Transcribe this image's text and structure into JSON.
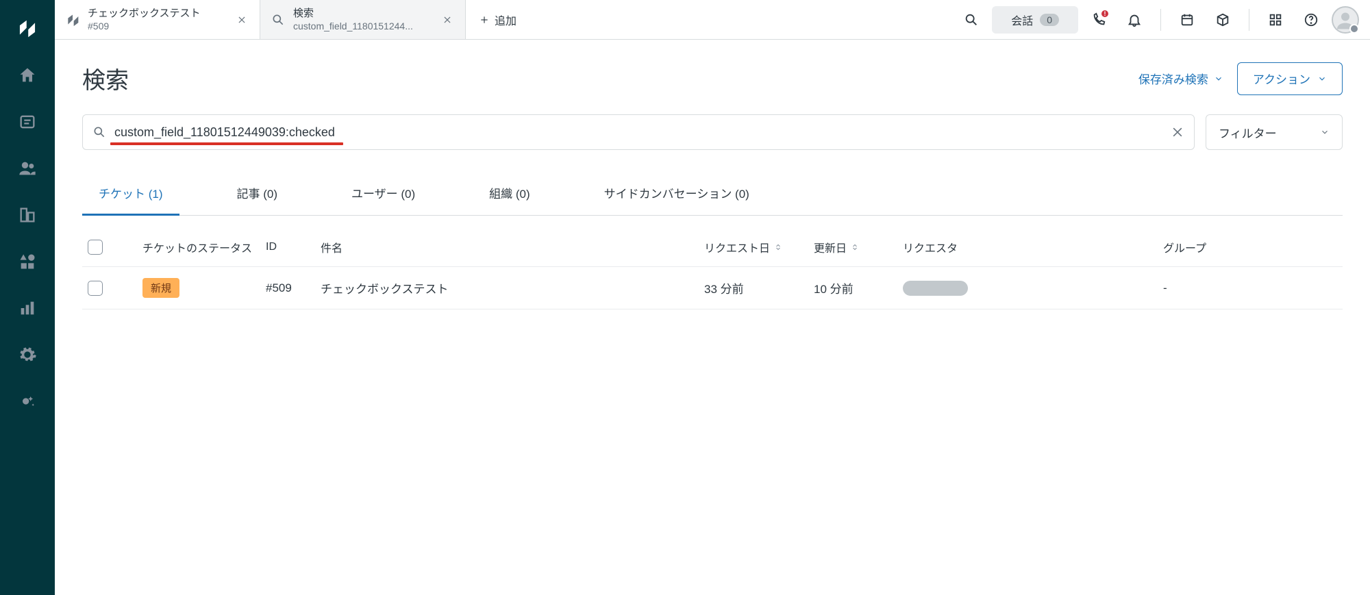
{
  "tabs": [
    {
      "title": "チェックボックステスト",
      "sub": "#509"
    },
    {
      "title": "検索",
      "sub": "custom_field_11801512449039:checked"
    }
  ],
  "tabs_display": {
    "tab1_sub": "custom_field_1180151244..."
  },
  "add_tab_label": "追加",
  "top": {
    "conversation_label": "会話",
    "conversation_count": "0"
  },
  "page": {
    "title": "検索",
    "saved_search": "保存済み検索",
    "action_button": "アクション"
  },
  "search": {
    "value": "custom_field_11801512449039:checked",
    "filter_label": "フィルター"
  },
  "result_tabs": [
    {
      "label": "チケット (1)",
      "active": true
    },
    {
      "label": "記事 (0)"
    },
    {
      "label": "ユーザー (0)"
    },
    {
      "label": "組織 (0)"
    },
    {
      "label": "サイドカンバセーション (0)"
    }
  ],
  "columns": {
    "status": "チケットのステータス",
    "id": "ID",
    "subject": "件名",
    "requested": "リクエスト日",
    "updated": "更新日",
    "requester": "リクエスタ",
    "group": "グループ"
  },
  "rows": [
    {
      "status": "新規",
      "id": "#509",
      "subject": "チェックボックステスト",
      "requested": "33 分前",
      "updated": "10 分前",
      "group": "-"
    }
  ]
}
